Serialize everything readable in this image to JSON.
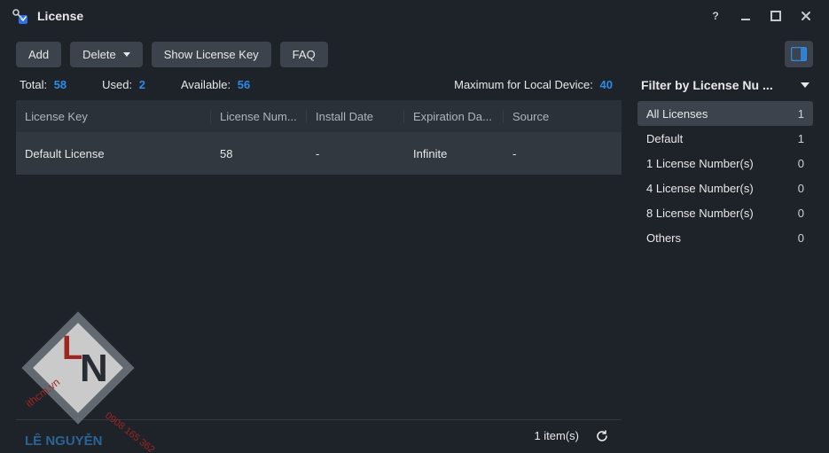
{
  "window": {
    "title": "License"
  },
  "toolbar": {
    "add": "Add",
    "delete": "Delete",
    "show_key": "Show License Key",
    "faq": "FAQ"
  },
  "stats": {
    "total_label": "Total:",
    "total_value": "58",
    "used_label": "Used:",
    "used_value": "2",
    "available_label": "Available:",
    "available_value": "56",
    "max_label": "Maximum for Local Device:",
    "max_value": "40"
  },
  "table": {
    "columns": {
      "key": "License Key",
      "num": "License Num...",
      "install": "Install Date",
      "expire": "Expiration Da...",
      "source": "Source"
    },
    "rows": [
      {
        "key": "Default License",
        "num": "58",
        "install": "-",
        "expire": "Infinite",
        "source": "-"
      }
    ],
    "footer_count": "1 item(s)"
  },
  "filter": {
    "header": "Filter by License Nu",
    "header_ellipsis": "...",
    "items": [
      {
        "label": "All Licenses",
        "count": "1",
        "selected": true
      },
      {
        "label": "Default",
        "count": "1",
        "selected": false
      },
      {
        "label": "1 License Number(s)",
        "count": "0",
        "selected": false
      },
      {
        "label": "4 License Number(s)",
        "count": "0",
        "selected": false
      },
      {
        "label": "8 License Number(s)",
        "count": "0",
        "selected": false
      },
      {
        "label": "Others",
        "count": "0",
        "selected": false
      }
    ]
  },
  "watermark": {
    "line1": "ithcm.vn",
    "line2": "0908 165 362",
    "line3": "LÊ NGUYỄN"
  }
}
